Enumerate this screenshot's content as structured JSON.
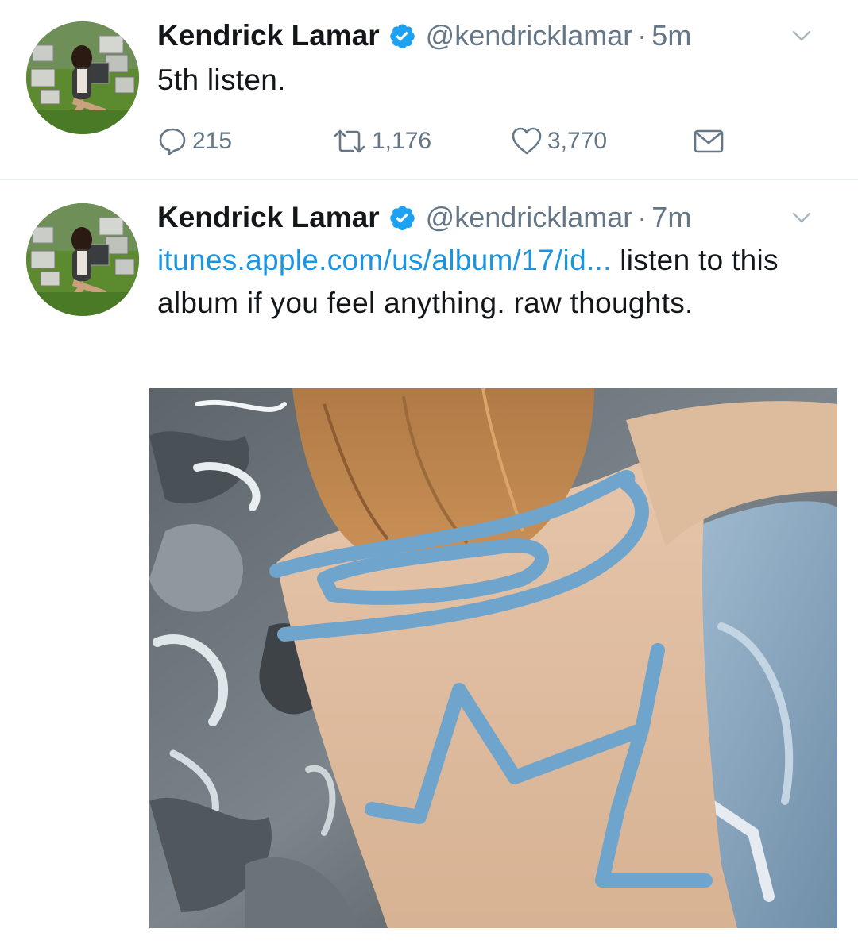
{
  "tweets": [
    {
      "author_name": "Kendrick Lamar",
      "handle": "@kendricklamar",
      "separator": "·",
      "time": "5m",
      "text": "5th listen.",
      "reply_count": "215",
      "retweet_count": "1,176",
      "like_count": "3,770",
      "verified_icon": "verified-badge-icon",
      "menu_icon": "chevron-down-icon"
    },
    {
      "author_name": "Kendrick Lamar",
      "handle": "@kendricklamar",
      "separator": "·",
      "time": "7m",
      "link_text": "itunes.apple.com/us/album/17/id...",
      "text_after_link": " listen to this album if you feel anything. raw thoughts.",
      "verified_icon": "verified-badge-icon",
      "menu_icon": "chevron-down-icon",
      "media": "album-cover-image"
    }
  ],
  "colors": {
    "link": "#1b95e0",
    "secondary_text": "#657786",
    "verified": "#1da1f2",
    "divider": "#e6ecf0"
  }
}
